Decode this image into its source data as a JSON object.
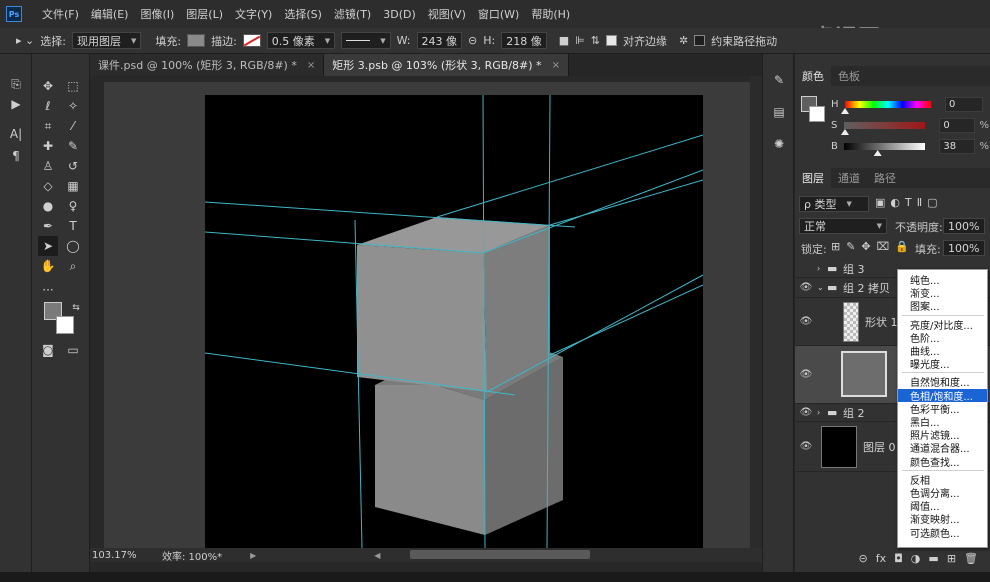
{
  "app": {
    "logo": "Ps"
  },
  "menu": [
    "文件(F)",
    "编辑(E)",
    "图像(I)",
    "图层(L)",
    "文字(Y)",
    "选择(S)",
    "滤镜(T)",
    "3D(D)",
    "视图(V)",
    "窗口(W)",
    "帮助(H)"
  ],
  "options": {
    "select_label": "选择:",
    "select_value": "现用图层",
    "fill_label": "填充:",
    "stroke_label": "描边:",
    "stroke_width": "0.5 像素",
    "w_label": "W:",
    "w_value": "243 像",
    "h_label": "H:",
    "h_value": "218 像",
    "align_edges": "对齐边缘",
    "constrain_path": "约束路径拖动",
    "fill_color": "#8a8a8a"
  },
  "tabs": [
    {
      "label": "课件.psd @ 100% (矩形 3, RGB/8#) *",
      "close": "×"
    },
    {
      "label": "矩形 3.psb @ 103% (形状 3, RGB/8#) *",
      "close": "×"
    }
  ],
  "status": {
    "zoom": "103.17%",
    "efficiency": "效率: 100%*"
  },
  "color_panel": {
    "tabs": [
      "颜色",
      "色板"
    ],
    "channels": [
      {
        "label": "H",
        "value": "0",
        "unit": ""
      },
      {
        "label": "S",
        "value": "0",
        "unit": "%"
      },
      {
        "label": "B",
        "value": "38",
        "unit": "%"
      }
    ],
    "levels": {
      "H": 0,
      "S": 0,
      "B": 0.38
    }
  },
  "layers_panel": {
    "tabs": [
      "图层",
      "通道",
      "路径"
    ],
    "filter": "ρ 类型",
    "blend_mode": "正常",
    "opacity_label": "不透明度:",
    "opacity_value": "100%",
    "lock_label": "锁定:",
    "fill_label": "填充:",
    "fill_value": "100%",
    "layers": [
      {
        "name": "组 3"
      },
      {
        "name": "组 2 拷贝"
      },
      {
        "name": "形状 1"
      },
      {
        "name": ""
      },
      {
        "name": "组 2"
      },
      {
        "name": "图层 0"
      }
    ]
  },
  "context_menu": {
    "items": [
      "纯色...",
      "渐变...",
      "图案...",
      "亮度/对比度...",
      "色阶...",
      "曲线...",
      "曝光度...",
      "自然饱和度...",
      "色相/饱和度...",
      "色彩平衡...",
      "黑白...",
      "照片滤镜...",
      "通道混合器...",
      "颜色查找...",
      "反相",
      "色调分离...",
      "阈值...",
      "渐变映射...",
      "可选颜色..."
    ],
    "highlighted": "色相/饱和度..."
  },
  "watermark": "虎课网",
  "colors": {
    "guide": "#3fb6c6",
    "cube": "#8c8c8c",
    "highlight": "#1a64d6"
  }
}
